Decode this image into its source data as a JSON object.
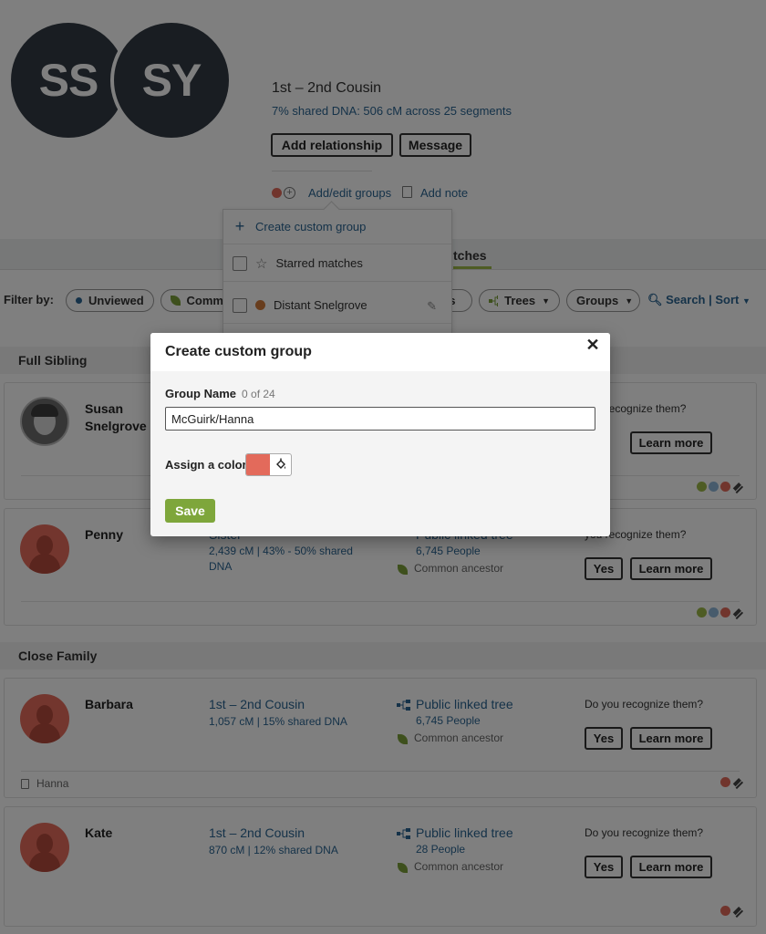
{
  "header": {
    "avatar1_initials": "SS",
    "avatar2_initials": "SY",
    "relationship": "1st – 2nd Cousin",
    "dna_summary": "7% shared DNA: 506 cM across 25 segments",
    "add_relationship_label": "Add relationship",
    "message_label": "Message",
    "add_edit_groups_label": "Add/edit groups",
    "add_note_label": "Add note",
    "group_dot_color": "#e36a5b"
  },
  "dropdown": {
    "create_label": "Create custom group",
    "items": [
      {
        "label": "Starred matches",
        "icon": "star-icon"
      },
      {
        "label": "Distant Snelgrove",
        "icon": "color-dot",
        "color": "#d07a3a"
      }
    ]
  },
  "tabs": {
    "active_partial": "tches"
  },
  "filters": {
    "label": "Filter by:",
    "unviewed": "Unviewed",
    "common_partial": "Comm",
    "types_partial": "es",
    "trees": "Trees",
    "groups": "Groups",
    "search_sort": "Search | Sort"
  },
  "sections": {
    "full_sibling": "Full Sibling",
    "close_family": "Close Family"
  },
  "cards": [
    {
      "name": "Susan Snelgrove",
      "recognize": "you recognize them?",
      "learn_more": "Learn more",
      "dots": [
        "#9cb848",
        "#8fb6d8",
        "#e36a5b"
      ]
    },
    {
      "name": "Penny",
      "relationship_partial": "Sister",
      "dna": "2,439 cM | 43% - 50% shared DNA",
      "tree_label": "Public linked tree",
      "people": "6,745 People",
      "ancestor": "Common ancestor",
      "recognize": "you recognize them?",
      "yes": "Yes",
      "learn_more": "Learn more",
      "dots": [
        "#9cb848",
        "#8fb6d8",
        "#e36a5b"
      ]
    },
    {
      "name": "Barbara",
      "relationship": "1st – 2nd Cousin",
      "dna": "1,057 cM | 15% shared DNA",
      "tree_label": "Public linked tree",
      "people": "6,745 People",
      "ancestor": "Common ancestor",
      "recognize": "Do you recognize them?",
      "yes": "Yes",
      "learn_more": "Learn more",
      "note": "Hanna",
      "dots": [
        "#e36a5b"
      ]
    },
    {
      "name": "Kate",
      "relationship": "1st – 2nd Cousin",
      "dna": "870 cM | 12% shared DNA",
      "tree_label": "Public linked tree",
      "people": "28 People",
      "ancestor": "Common ancestor",
      "recognize": "Do you recognize them?",
      "yes": "Yes",
      "learn_more": "Learn more",
      "dots": [
        "#e36a5b"
      ]
    }
  ],
  "modal": {
    "title": "Create custom group",
    "close_glyph": "✕",
    "group_name_label": "Group Name",
    "char_count": "0 of 24",
    "group_name_value": "McGuirk/Hanna",
    "assign_color_label": "Assign a color",
    "selected_color": "#e36a5b",
    "save_label": "Save"
  }
}
